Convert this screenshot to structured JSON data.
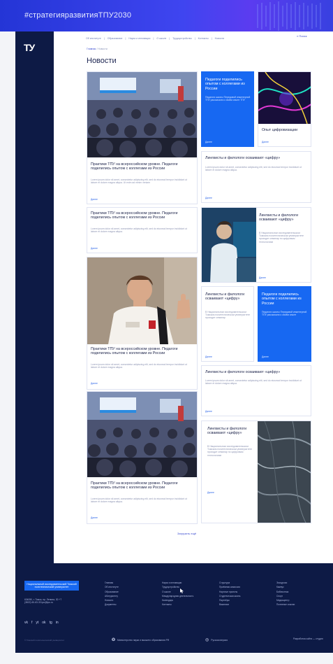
{
  "banner": {
    "title": "#стратегияразвитияТПУ2030"
  },
  "logo": "ТУ",
  "topnav": {
    "items": [
      "Об институте",
      "Образование",
      "Наука и инновации",
      "О школе",
      "Трудоустройство",
      "Контакты",
      "Новости"
    ],
    "search_label": "Поиск"
  },
  "breadcrumbs": {
    "home": "Главная",
    "current": "Новости"
  },
  "page_title": "Новости",
  "cards": [
    {
      "title": "Практики ТПУ на всероссийском уровне. Педагоги поделились опытом с коллегами из России",
      "text": "Lorem ipsum dolor sit amet, consectetur adipiscing elit, sed do eiusmod tempor incididunt ut labore et dolore magna aliqua. Ut enim ad minim veniam",
      "more": "Далее"
    },
    {
      "title": "Педагоги поделились опытом с коллегами из России",
      "text": "Педагоги школы Передовой инженерной ТПУ рассказали о своём опыте ТПУ",
      "more": "Далее"
    },
    {
      "title": "Опыт цифровизации",
      "more": "Далее"
    },
    {
      "title": "Лингвисты и филологи осваивают «цифру»",
      "text": "Lorem ipsum dolor sit amet, consectetur adipiscing elit, sed do eiusmod tempor incididunt ut labore et dolore magna aliqua.",
      "more": "Далее"
    },
    {
      "title": "Практики ТПУ на всероссийском уровне. Педагоги поделились опытом с коллегами из России",
      "text": "Lorem ipsum dolor sit amet, consectetur adipiscing elit, sed do eiusmod tempor incididunt ut labore et dolore magna aliqua.",
      "more": "Далее"
    },
    {
      "title": "Лингвисты и филологи осваивают «цифру»",
      "text": "В Национальном исследовательском Томском политехническом университете проходит семинар по цифровым технологиям",
      "more": "Далее"
    },
    {
      "title": "Практики ТПУ на всероссийском уровне. Педагоги поделились опытом с коллегами из России",
      "text": "Lorem ipsum dolor sit amet, consectetur adipiscing elit, sed do eiusmod tempor incididunt ut labore et dolore magna aliqua.",
      "more": "Далее"
    },
    {
      "title": "Лингвисты и филологи осваивают «цифру»",
      "text": "В Национальном исследовательском Томском политехническом университете проходит семинар",
      "more": "Далее"
    },
    {
      "title": "Педагоги поделились опытом с коллегами из России",
      "text": "Педагоги школы Передовой инженерной ТПУ рассказали о своём опыте",
      "more": "Далее"
    },
    {
      "title": "Лингвисты и филологи осваивают «цифру»",
      "text": "Lorem ipsum dolor sit amet, consectetur adipiscing elit, sed do eiusmod tempor incididunt ut labore et dolore magna aliqua.",
      "more": "Далее"
    },
    {
      "title": "Практики ТПУ на всероссийском уровне. Педагоги поделились опытом с коллегами из России",
      "text": "Lorem ipsum dolor sit amet, consectetur adipiscing elit, sed do eiusmod tempor incididunt ut labore et dolore magna aliqua.",
      "more": "Далее"
    },
    {
      "title": "Лингвисты и филологи осваивают «цифру»",
      "text": "В Национальном исследовательском Томском политехническом университете проходит семинар по цифровым технологиям",
      "more": "Далее"
    }
  ],
  "load_more": "Загрузить ещё",
  "footer": {
    "button": "Национальный исследовательский Томский политехнический университет",
    "address": "634050, г. Томск, пр. Ленина, 30 +7 (3822) 60-63-33 tpu@tpu.ru",
    "social": [
      "vk",
      "f",
      "yt",
      "ok",
      "tg",
      "in"
    ],
    "columns": [
      [
        "Главная",
        "Об институте",
        "Образование",
        "Абитуриенту",
        "Новости",
        "Документы"
      ],
      [
        "Наука и инновации",
        "Трудоустройство",
        "О школе",
        "Международная деятельность",
        "Календарь",
        "Контакты"
      ],
      [
        "Структура",
        "Приёмная комиссия",
        "Научные проекты",
        "Студенческая жизнь",
        "Партнёры",
        "Вакансии"
      ],
      [
        "Экскурсии",
        "Кампус",
        "Библиотека",
        "Спорт",
        "Медиацентр",
        "Полезные ссылки"
      ]
    ],
    "copyright": "© Томский политехнический университет",
    "ministry": "Министерство науки и высшего образования РФ",
    "ru_link": "Русская версия",
    "developer": "Разработка сайта — студия"
  },
  "colors": {
    "accent": "#1768f2",
    "dark": "#0d1a45",
    "banner": "#2f3fe6"
  }
}
